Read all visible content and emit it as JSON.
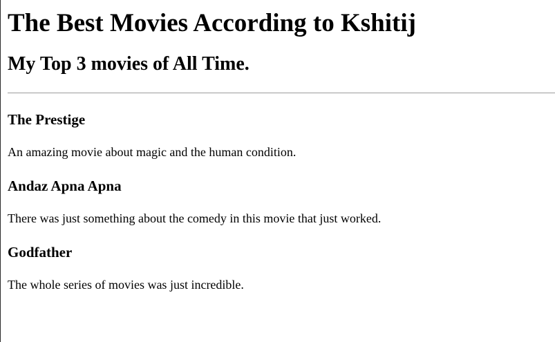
{
  "page": {
    "title": "The Best Movies According to Kshitij",
    "subtitle": "My Top 3 movies of All Time."
  },
  "movies": [
    {
      "title": "The Prestige",
      "description": "An amazing movie about magic and the human condition."
    },
    {
      "title": "Andaz Apna Apna",
      "description": "There was just something about the comedy in this movie that just worked."
    },
    {
      "title": "Godfather",
      "description": "The whole series of movies was just incredible."
    }
  ]
}
